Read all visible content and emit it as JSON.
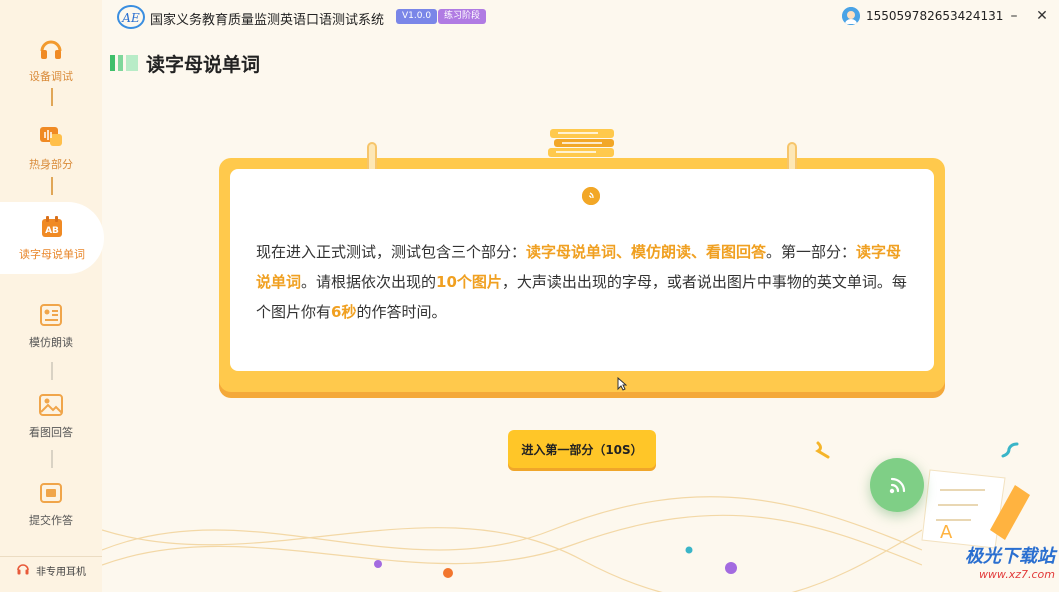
{
  "titlebar": {
    "app_title": "国家义务教育质量监测英语口语测试系统",
    "version": "V1.0.0",
    "phase": "练习阶段",
    "user_id": "1550597826534241​31",
    "minimize": "–",
    "close": "✕"
  },
  "sidebar": {
    "items": [
      {
        "label": "设备调试",
        "icon": "headset-icon"
      },
      {
        "label": "热身部分",
        "icon": "chat-icon"
      },
      {
        "label": "读字母说单词",
        "icon": "ab-calendar-icon"
      },
      {
        "label": "模仿朗读",
        "icon": "reading-icon"
      },
      {
        "label": "看图回答",
        "icon": "picture-icon"
      },
      {
        "label": "提交作答",
        "icon": "submit-icon"
      }
    ],
    "headset_status": "非专用耳机"
  },
  "section": {
    "title": "读字母说单词"
  },
  "instructions": {
    "p1": "现在进入正式测试，测试包含三个部分：",
    "h1": "读字母说单词、模仿朗读、看图回答",
    "p2": "。第一部分：",
    "h2": "读字母说单词",
    "p3": "。请根据依次出现的",
    "h3": "10个图片",
    "p4": "，大声读出出现的字母，或者说出图片中事物的英文单词。每个图片你有",
    "h4": "6秒",
    "p5": "的作答时间。"
  },
  "enter_button": "进入第一部分（10S）",
  "watermark": {
    "name": "极光下载站",
    "url": "www.xz7.com"
  },
  "colors": {
    "accent": "#ffc628",
    "highlight": "#f0a021",
    "sidebar_active": "#e8862a"
  }
}
